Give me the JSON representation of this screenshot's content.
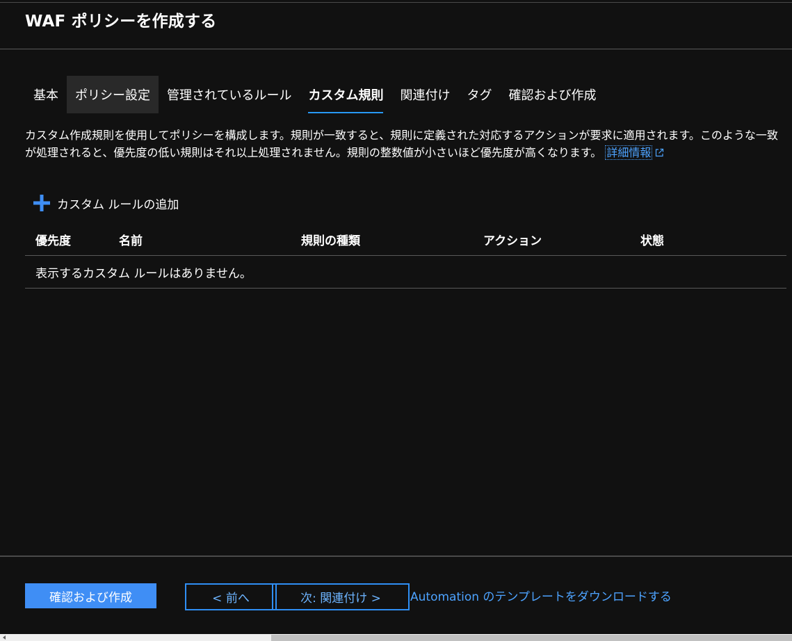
{
  "header": {
    "title": "WAF ポリシーを作成する"
  },
  "tabs": [
    {
      "label": "基本"
    },
    {
      "label": "ポリシー設定"
    },
    {
      "label": "管理されているルール"
    },
    {
      "label": "カスタム規則"
    },
    {
      "label": "関連付け"
    },
    {
      "label": "タグ"
    },
    {
      "label": "確認および作成"
    }
  ],
  "description": {
    "text": "カスタム作成規則を使用してポリシーを構成します。規則が一致すると、規則に定義された対応するアクションが要求に適用されます。このような一致が処理されると、優先度の低い規則はそれ以上処理されません。規則の整数値が小さいほど優先度が高くなります。",
    "link_label": "詳細情報"
  },
  "add_rule": {
    "label": "カスタム ルールの追加"
  },
  "table": {
    "columns": [
      "優先度",
      "名前",
      "規則の種類",
      "アクション",
      "状態"
    ],
    "empty_message": "表示するカスタム ルールはありません。"
  },
  "footer": {
    "review_create_label": "確認および作成",
    "prev_label": "< 前へ",
    "next_label": "次: 関連付け >",
    "automation_label": "Automation のテンプレートをダウンロードする"
  },
  "colors": {
    "background": "#111111",
    "accent": "#3f8ef5",
    "link": "#4da3ff",
    "active_tab_underline": "#2899f5"
  }
}
